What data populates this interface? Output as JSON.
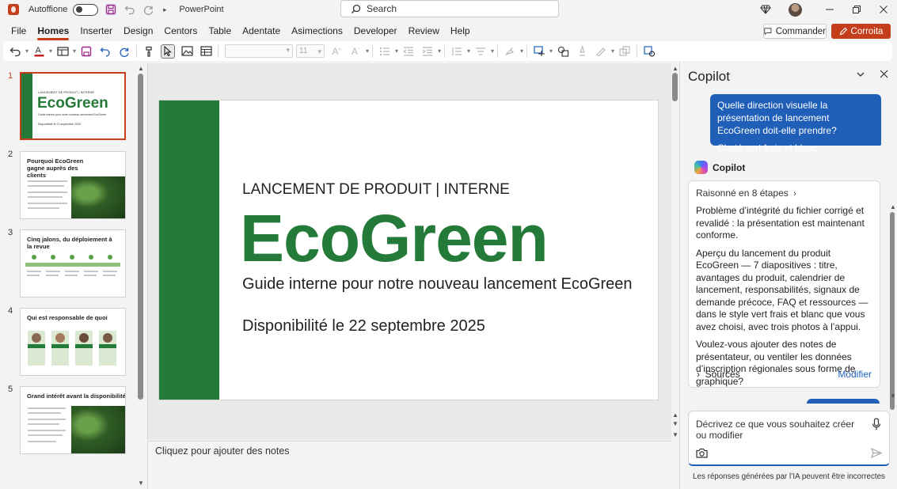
{
  "titlebar": {
    "autosave_label": "Autoffione",
    "app_name": "PowerPoint",
    "search_placeholder": "Search"
  },
  "menu": {
    "items": [
      "File",
      "Homes",
      "Inserter",
      "Design",
      "Centors",
      "Table",
      "Adentate",
      "Asimections",
      "Developer",
      "Review",
      "Help"
    ],
    "active": "Homes",
    "commander_label": "Commander",
    "copilot_label": "Corroita"
  },
  "ribbon": {
    "font_size": "11"
  },
  "thumbnails": [
    {
      "number": "1",
      "kicker": "LANCEMENT DE PRODUIT | INTERNE",
      "title": "EcoGreen",
      "subtitle": "Guide interne pour notre nouveau lancement EcoGreen",
      "date": "Disponibilité le 21 septembre 2025"
    },
    {
      "number": "2",
      "title": "Pourquoi EcoGreen gagne auprès des clients"
    },
    {
      "number": "3",
      "title": "Cinq jalons, du déploiement à la revue"
    },
    {
      "number": "4",
      "title": "Qui est responsable de quoi"
    },
    {
      "number": "5",
      "title": "Grand intérêt avant la disponibilité"
    }
  ],
  "slide": {
    "kicker": "LANCEMENT DE PRODUIT | INTERNE",
    "title": "EcoGreen",
    "subtitle": "Guide interne pour notre nouveau lancement EcoGreen",
    "date": "Disponibilité le 22 septembre 2025"
  },
  "notes_placeholder": "Cliquez pour ajouter des notes",
  "copilot": {
    "header": "Copilot",
    "user_message": "Quelle direction visuelle la présentation de lancement EcoGreen doit-elle prendre?",
    "user_answer": "Clarté vert frais et blanc",
    "brand": "Copilot",
    "reasoning": "Raisonné en 8 étapes",
    "paragraphs": [
      "Problème d’intégrité du fichier corrigé et revalidé : la présentation est maintenant conforme.",
      "Aperçu du lancement du produit EcoGreen — 7 diapositives : titre, avantages du produit, calendrier de lancement, responsabilités, signaux de demande précoce, FAQ et ressources — dans le style vert frais et blanc que vous avez choisi, avec trois photos à l’appui.",
      "Voulez-vous ajouter des notes de présentateur, ou ventiler les données d’inscription régionales sous forme de graphique?"
    ],
    "sources_label": "Sources",
    "modify_label": "Modifier",
    "input_placeholder": "Décrivez ce que vous souhaitez créer ou modifier",
    "disclaimer": "Les réponses générées par l’IA peuvent être incorrectes"
  },
  "colors": {
    "accent": "#c43e1c",
    "brand_green": "#247a38",
    "copilot_blue": "#1f5fb8"
  }
}
